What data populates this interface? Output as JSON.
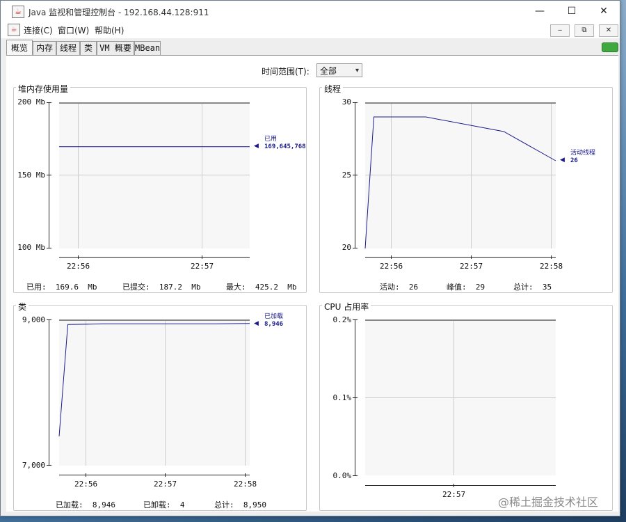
{
  "window": {
    "title": "Java 监视和管理控制台 - 192.168.44.128:911",
    "minimize": "—",
    "maximize": "☐",
    "close": "✕"
  },
  "menu": {
    "items": [
      "连接(C)",
      "窗口(W)",
      "帮助(H)"
    ],
    "mdi_buttons": [
      "‒",
      "⧉",
      "✕"
    ]
  },
  "tabs": [
    "概览",
    "内存",
    "线程",
    "类",
    "VM 概要",
    "MBean"
  ],
  "time_range": {
    "label": "时间范围(T):",
    "value": "全部"
  },
  "colors": {
    "series": "#1a1a8c",
    "grid": "#cccccc",
    "plot_bg": "#f7f7f7"
  },
  "panels": {
    "heap": {
      "title": "堆内存使用量",
      "yticks": [
        "200 Mb",
        "150 Mb",
        "100 Mb"
      ],
      "xticks": [
        "22:56",
        "22:57"
      ],
      "series_name": "已用",
      "series_value": "169,645,768",
      "stats": [
        "已用:  169.6  Mb",
        "已提交:  187.2  Mb",
        "最大:  425.2  Mb"
      ]
    },
    "threads": {
      "title": "线程",
      "yticks": [
        "30",
        "25",
        "20"
      ],
      "xticks": [
        "22:56",
        "22:57",
        "22:58"
      ],
      "series_name": "活动线程",
      "series_value": "26",
      "stats": [
        "活动:  26",
        "峰值:  29",
        "总计:  35"
      ]
    },
    "classes": {
      "title": "类",
      "yticks": [
        "9,000",
        "7,000"
      ],
      "xticks": [
        "22:56",
        "22:57",
        "22:58"
      ],
      "series_name": "已加载",
      "series_value": "8,946",
      "stats": [
        "已加载:  8,946",
        "已卸载:  4",
        "总计:  8,950"
      ]
    },
    "cpu": {
      "title": "CPU 占用率",
      "yticks": [
        "0.2%",
        "0.1%",
        "0.0%"
      ],
      "xticks": [
        "22:57"
      ]
    }
  },
  "chart_data": [
    {
      "type": "line",
      "title": "堆内存使用量",
      "ylabel": "Mb",
      "ylim": [
        100,
        200
      ],
      "x": [
        "22:55.8",
        "22:57.5"
      ],
      "series": [
        {
          "name": "已用",
          "values": [
            169.6,
            169.6
          ]
        }
      ]
    },
    {
      "type": "line",
      "title": "线程",
      "ylim": [
        20,
        30
      ],
      "x": [
        "22:55.8",
        "22:55.9",
        "22:56.5",
        "22:57.4",
        "22:58"
      ],
      "series": [
        {
          "name": "活动线程",
          "values": [
            20,
            29,
            29,
            28,
            26
          ]
        }
      ]
    },
    {
      "type": "line",
      "title": "类",
      "ylim": [
        7000,
        9000
      ],
      "x": [
        "22:55.8",
        "22:55.9",
        "22:56.3",
        "22:57.6",
        "22:58"
      ],
      "series": [
        {
          "name": "已加载",
          "values": [
            7400,
            8930,
            8940,
            8940,
            8946
          ]
        }
      ]
    },
    {
      "type": "line",
      "title": "CPU 占用率",
      "ylim": [
        0,
        0.2
      ],
      "series": []
    }
  ]
}
